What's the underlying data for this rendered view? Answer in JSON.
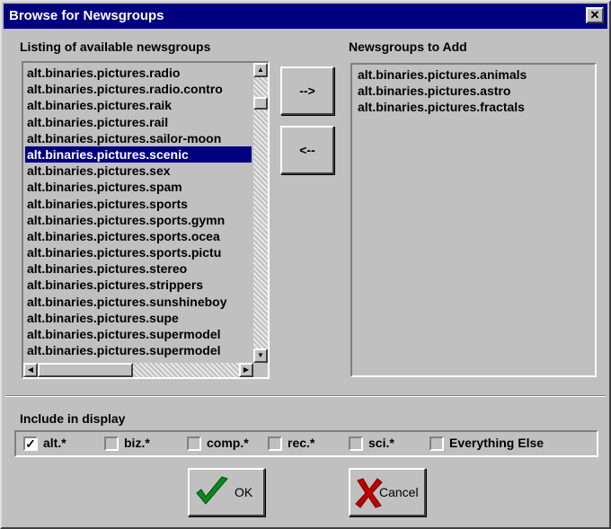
{
  "window": {
    "title": "Browse for Newsgroups",
    "close_glyph": "✕"
  },
  "available": {
    "label": "Listing of available newsgroups",
    "items": [
      "alt.binaries.pictures.radio",
      "alt.binaries.pictures.radio.contro",
      "alt.binaries.pictures.raik",
      "alt.binaries.pictures.rail",
      "alt.binaries.pictures.sailor-moon",
      "alt.binaries.pictures.scenic",
      "alt.binaries.pictures.sex",
      "alt.binaries.pictures.spam",
      "alt.binaries.pictures.sports",
      "alt.binaries.pictures.sports.gymn",
      "alt.binaries.pictures.sports.ocea",
      "alt.binaries.pictures.sports.pictu",
      "alt.binaries.pictures.stereo",
      "alt.binaries.pictures.strippers",
      "alt.binaries.pictures.sunshineboy",
      "alt.binaries.pictures.supe",
      "alt.binaries.pictures.supermodel",
      "alt.binaries.pictures.supermodel"
    ],
    "selected_index": 5
  },
  "to_add": {
    "label": "Newsgroups to Add",
    "items": [
      "alt.binaries.pictures.animals",
      "alt.binaries.pictures.astro",
      "alt.binaries.pictures.fractals"
    ]
  },
  "buttons": {
    "add": "-->",
    "remove": "<--",
    "ok": "OK",
    "cancel": "Cancel"
  },
  "filters": {
    "label": "Include in display",
    "options": [
      {
        "label": "alt.*",
        "checked": true
      },
      {
        "label": "biz.*",
        "checked": false
      },
      {
        "label": "comp.*",
        "checked": false
      },
      {
        "label": "rec.*",
        "checked": false
      },
      {
        "label": "sci.*",
        "checked": false
      },
      {
        "label": "Everything Else",
        "checked": false
      }
    ]
  },
  "icons": {
    "ok": "checkmark-icon",
    "cancel": "x-mark-icon"
  },
  "colors": {
    "titlebar": "#000080",
    "selection": "#000080",
    "face": "#c0c0c0",
    "ok_check": "#0a8a1a",
    "cancel_x": "#c00000"
  }
}
